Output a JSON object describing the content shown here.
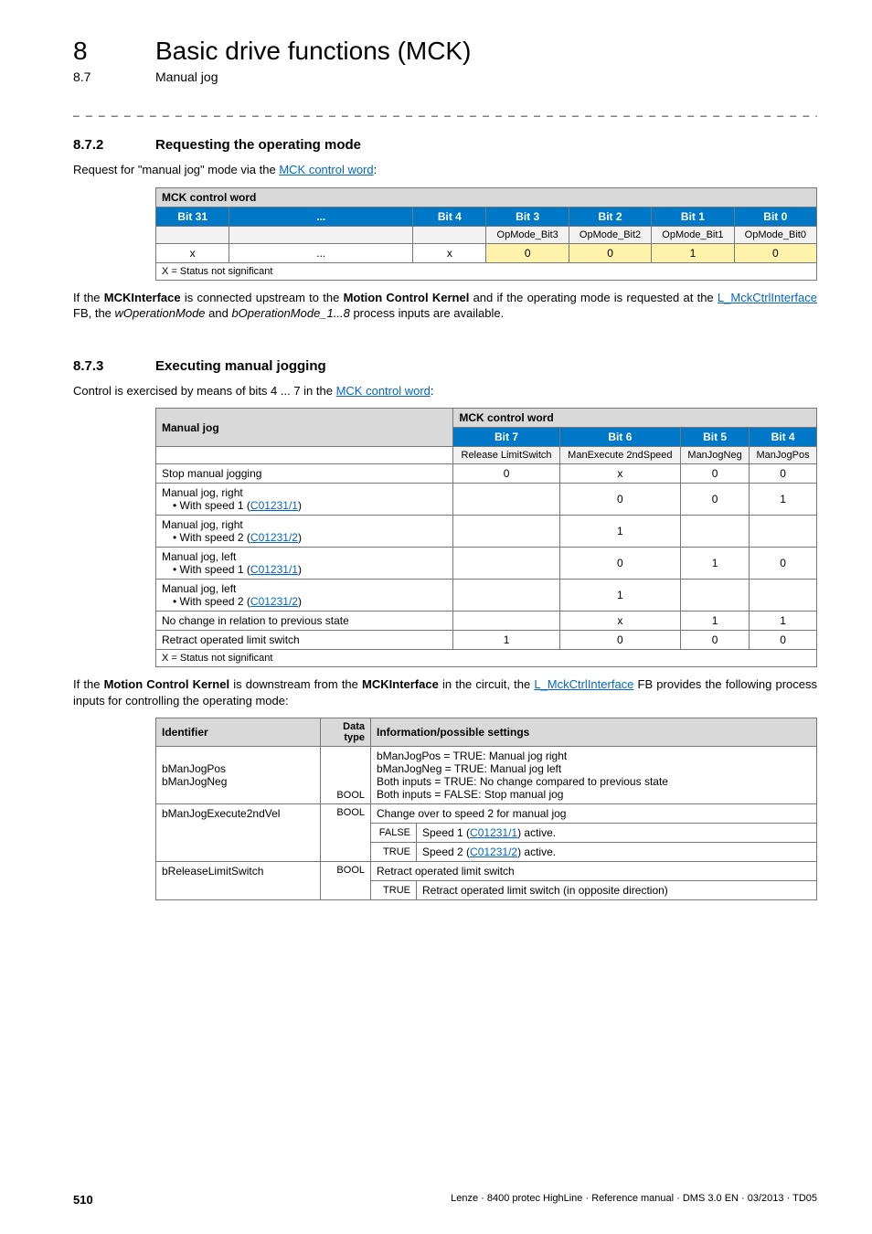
{
  "header": {
    "chapter_num": "8",
    "chapter_title": "Basic drive functions (MCK)",
    "section_num": "8.7",
    "section_title": "Manual jog"
  },
  "s872": {
    "num": "8.7.2",
    "title": "Requesting the operating mode",
    "intro_pre": "Request for \"manual jog\" mode via the ",
    "intro_link": "MCK control word",
    "intro_post": ":",
    "table": {
      "caption": "MCK control word",
      "cols": [
        "Bit 31",
        "...",
        "Bit 4",
        "Bit 3",
        "Bit 2",
        "Bit 1",
        "Bit 0"
      ],
      "sub": [
        "",
        "",
        "",
        "OpMode_Bit3",
        "OpMode_Bit2",
        "OpMode_Bit1",
        "OpMode_Bit0"
      ],
      "vals": [
        "x",
        "...",
        "x",
        "0",
        "0",
        "1",
        "0"
      ],
      "footnote": "X = Status not significant"
    },
    "after_pre": "If the ",
    "after_b1": "MCKInterface",
    "after_mid1": " is connected upstream to the ",
    "after_b2": "Motion Control Kernel",
    "after_mid2": " and if the operating mode is requested at the ",
    "after_link": "L_MckCtrlInterface",
    "after_mid3": " FB, the ",
    "after_i1": "wOperationMode",
    "after_mid4": " and ",
    "after_i2": "bOperationMode_1...8",
    "after_post": " process inputs are available."
  },
  "s873": {
    "num": "8.7.3",
    "title": "Executing manual jogging",
    "intro_pre": "Control is exercised by means of bits 4 ... 7 in the ",
    "intro_link": "MCK control word",
    "intro_post": ":",
    "table2": {
      "left_caption": "Manual jog",
      "right_caption": "MCK control word",
      "cols": [
        "Bit 7",
        "Bit 6",
        "Bit 5",
        "Bit 4"
      ],
      "sub": [
        "Release LimitSwitch",
        "ManExecute 2ndSpeed",
        "ManJogNeg",
        "ManJogPos"
      ],
      "rows": [
        {
          "label_plain": "Stop manual jogging",
          "b7": "0",
          "b6": "x",
          "b5": "0",
          "b4": "0"
        },
        {
          "label_a": "Manual jog, right",
          "label_b": "• With speed 1 (",
          "label_link": "C01231/1",
          "label_c": ")",
          "b7": "",
          "b6": "0",
          "b5": "0",
          "b4": "1"
        },
        {
          "label_a": "Manual jog, right",
          "label_b": "• With speed 2 (",
          "label_link": "C01231/2",
          "label_c": ")",
          "b7": "",
          "b6": "1",
          "b5": "",
          "b4": ""
        },
        {
          "label_a": "Manual jog, left",
          "label_b": "• With speed 1 (",
          "label_link": "C01231/1",
          "label_c": ")",
          "b7": "",
          "b6": "0",
          "b5": "1",
          "b4": "0"
        },
        {
          "label_a": "Manual jog, left",
          "label_b": "• With speed 2 (",
          "label_link": "C01231/2",
          "label_c": ")",
          "b7": "",
          "b6": "1",
          "b5": "",
          "b4": ""
        },
        {
          "label_plain": "No change in relation to previous state",
          "b7": "",
          "b6": "x",
          "b5": "1",
          "b4": "1"
        },
        {
          "label_plain": "Retract operated limit switch",
          "b7": "1",
          "b6": "0",
          "b5": "0",
          "b4": "0"
        }
      ],
      "footnote": "X = Status not significant"
    },
    "after2_pre": "If the ",
    "after2_b1": "Motion Control Kernel",
    "after2_mid1": " is downstream from the ",
    "after2_b2": "MCKInterface",
    "after2_mid2": " in the circuit, the ",
    "after2_link": "L_MckCtrlInterface",
    "after2_post": " FB provides the following process inputs for controlling the operating mode:",
    "table3": {
      "h_id": "Identifier",
      "h_dt": "Data type",
      "h_info": "Information/possible settings",
      "r1": {
        "id1": "bManJogPos",
        "id2": "bManJogNeg",
        "dt": "BOOL",
        "l1": "bManJogPos = TRUE: Manual jog right",
        "l2": "bManJogNeg = TRUE: Manual jog left",
        "l3": "Both inputs = TRUE: No change compared to previous state",
        "l4": "Both inputs = FALSE: Stop manual jog"
      },
      "r2": {
        "id": "bManJogExecute2ndVel",
        "dt": "BOOL",
        "desc": "Change over to speed 2 for manual jog",
        "false_lbl": "FALSE",
        "false_pre": "Speed 1 (",
        "false_link": "C01231/1",
        "false_post": ") active.",
        "true_lbl": "TRUE",
        "true_pre": "Speed 2 (",
        "true_link": "C01231/2",
        "true_post": ") active."
      },
      "r3": {
        "id": "bReleaseLimitSwitch",
        "dt": "BOOL",
        "desc": "Retract operated limit switch",
        "true_lbl": "TRUE",
        "true_txt": "Retract operated limit switch (in opposite direction)"
      }
    }
  },
  "footer": {
    "page": "510",
    "info": "Lenze · 8400 protec HighLine · Reference manual · DMS 3.0 EN · 03/2013 · TD05"
  }
}
